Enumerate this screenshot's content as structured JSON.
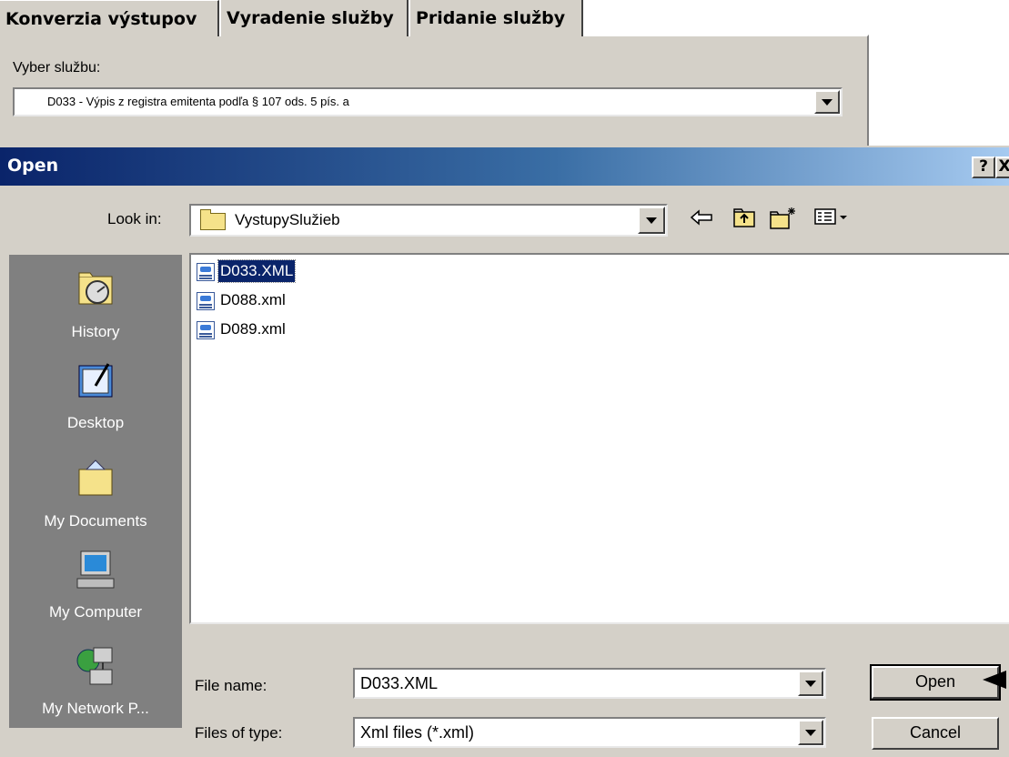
{
  "tabs": [
    {
      "label": "Konverzia výstupov"
    },
    {
      "label": "Vyradenie služby"
    },
    {
      "label": "Pridanie služby"
    }
  ],
  "service": {
    "label": "Vyber službu:",
    "selected": "D033 - Výpis z registra emitenta podľa § 107 ods. 5 pís. a"
  },
  "dialog": {
    "title": "Open",
    "help": "?",
    "close": "X",
    "look_in_label": "Look in:",
    "look_in_value": "VystupySlužieb",
    "places": [
      {
        "label": "History",
        "icon": "history-icon"
      },
      {
        "label": "Desktop",
        "icon": "desktop-icon"
      },
      {
        "label": "My Documents",
        "icon": "my-documents-icon"
      },
      {
        "label": "My Computer",
        "icon": "my-computer-icon"
      },
      {
        "label": "My Network P...",
        "icon": "network-places-icon"
      }
    ],
    "files": [
      {
        "name": "D033.XML",
        "selected": true
      },
      {
        "name": "D088.xml",
        "selected": false
      },
      {
        "name": "D089.xml",
        "selected": false
      }
    ],
    "file_name_label": "File name:",
    "file_name_value": "D033.XML",
    "file_type_label": "Files of type:",
    "file_type_value": "Xml files (*.xml)",
    "open_button": "Open",
    "cancel_button": "Cancel"
  },
  "colors": {
    "title_start": "#0a246a",
    "title_end": "#a6caf0",
    "face": "#d4d0c8",
    "places_bar": "#808080",
    "selection": "#0a246a"
  }
}
